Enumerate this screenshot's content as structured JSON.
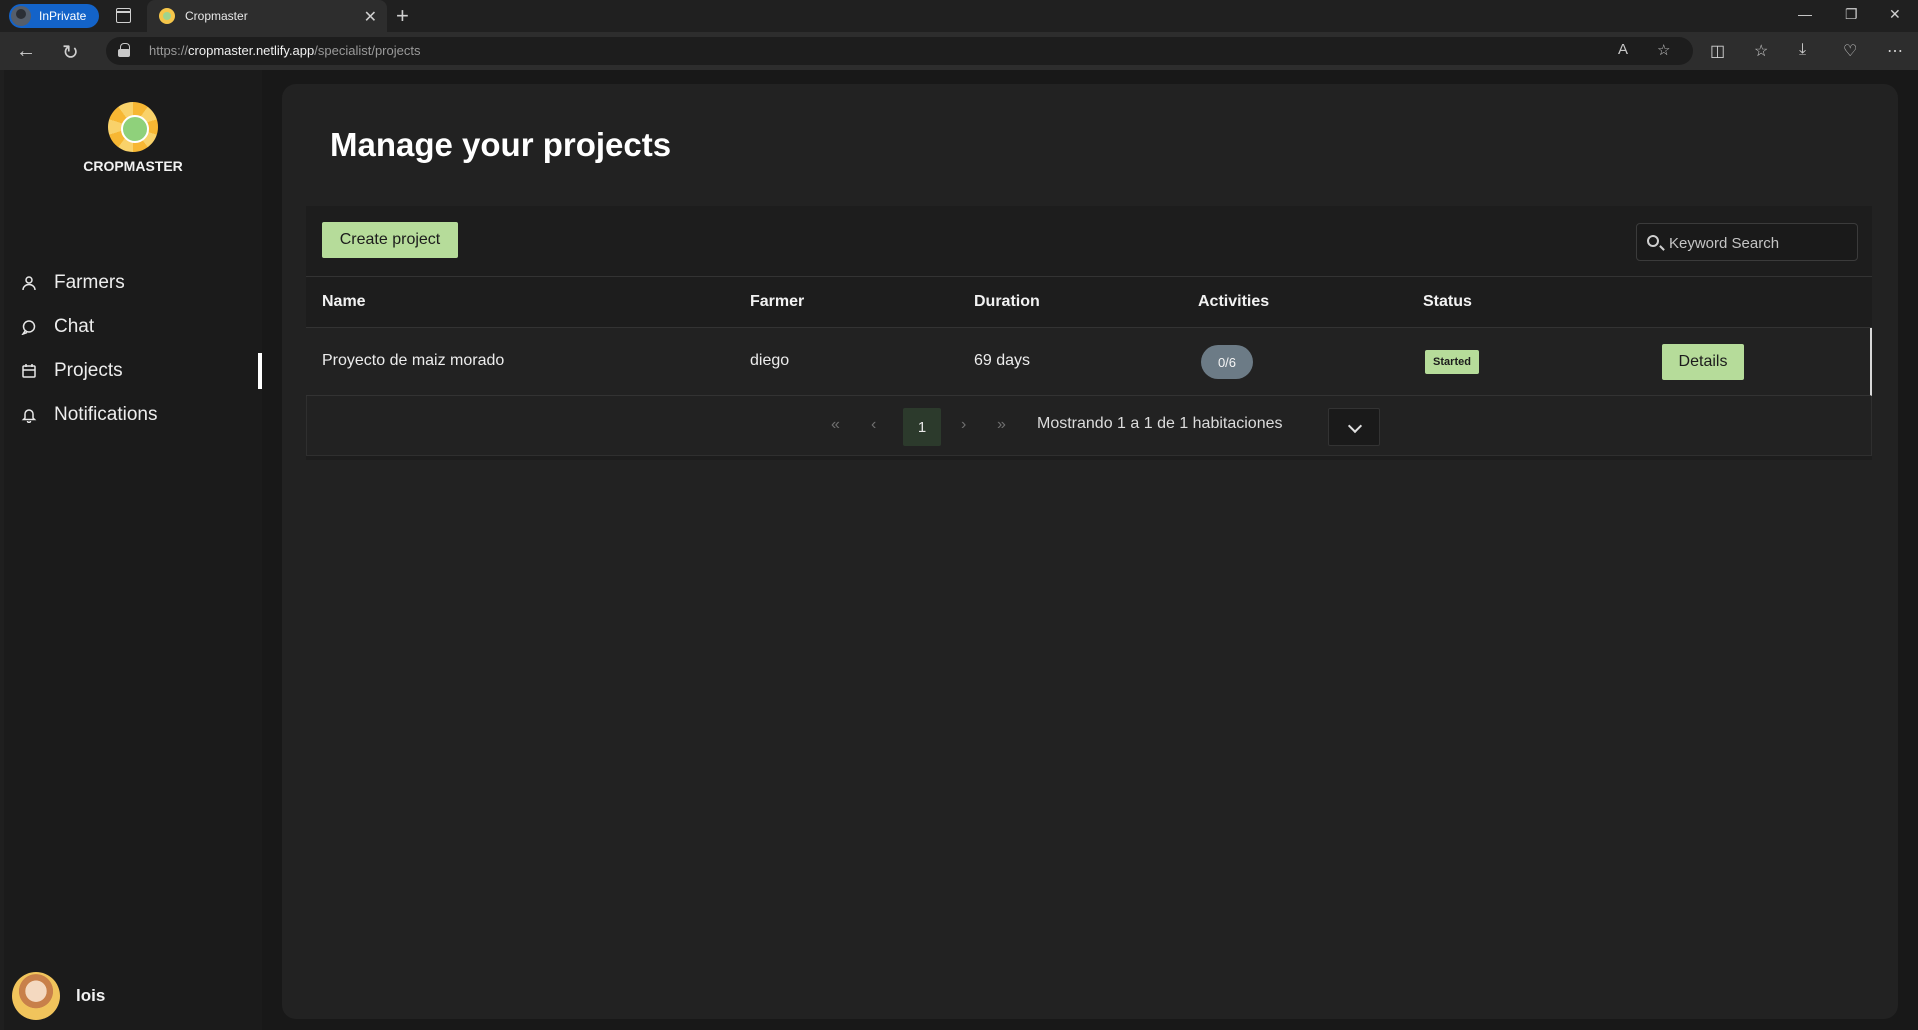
{
  "browser": {
    "inprivate_label": "InPrivate",
    "tab_title": "Cropmaster",
    "tab_close": "✕",
    "new_tab": "+",
    "url_scheme": "https://",
    "url_host": "cropmaster.netlify.app",
    "url_path": "/specialist/projects",
    "window_controls": [
      "—",
      "❐",
      "✕"
    ]
  },
  "sidebar": {
    "brand": "CROPMASTER",
    "items": [
      {
        "label": "Farmers",
        "icon": "user-icon"
      },
      {
        "label": "Chat",
        "icon": "chat-icon"
      },
      {
        "label": "Projects",
        "icon": "calendar-icon",
        "active": true
      },
      {
        "label": "Notifications",
        "icon": "bell-icon"
      }
    ],
    "user": {
      "name": "lois"
    }
  },
  "main": {
    "title": "Manage your projects",
    "create_button": "Create project",
    "search_placeholder": "Keyword Search",
    "columns": [
      "Name",
      "Farmer",
      "Duration",
      "Activities",
      "Status"
    ],
    "rows": [
      {
        "name": "Proyecto de maiz morado",
        "farmer": "diego",
        "duration": "69 days",
        "activities": "0/6",
        "status": "Started",
        "action": "Details"
      }
    ],
    "pagination": {
      "first": "«",
      "prev": "‹",
      "current_page": "1",
      "next": "›",
      "last": "»",
      "info": "Mostrando 1 a 1 de 1 habitaciones"
    }
  },
  "colors": {
    "accent_green": "#b6dc9a",
    "activity_badge": "#6c7b86",
    "panel": "#222222"
  }
}
